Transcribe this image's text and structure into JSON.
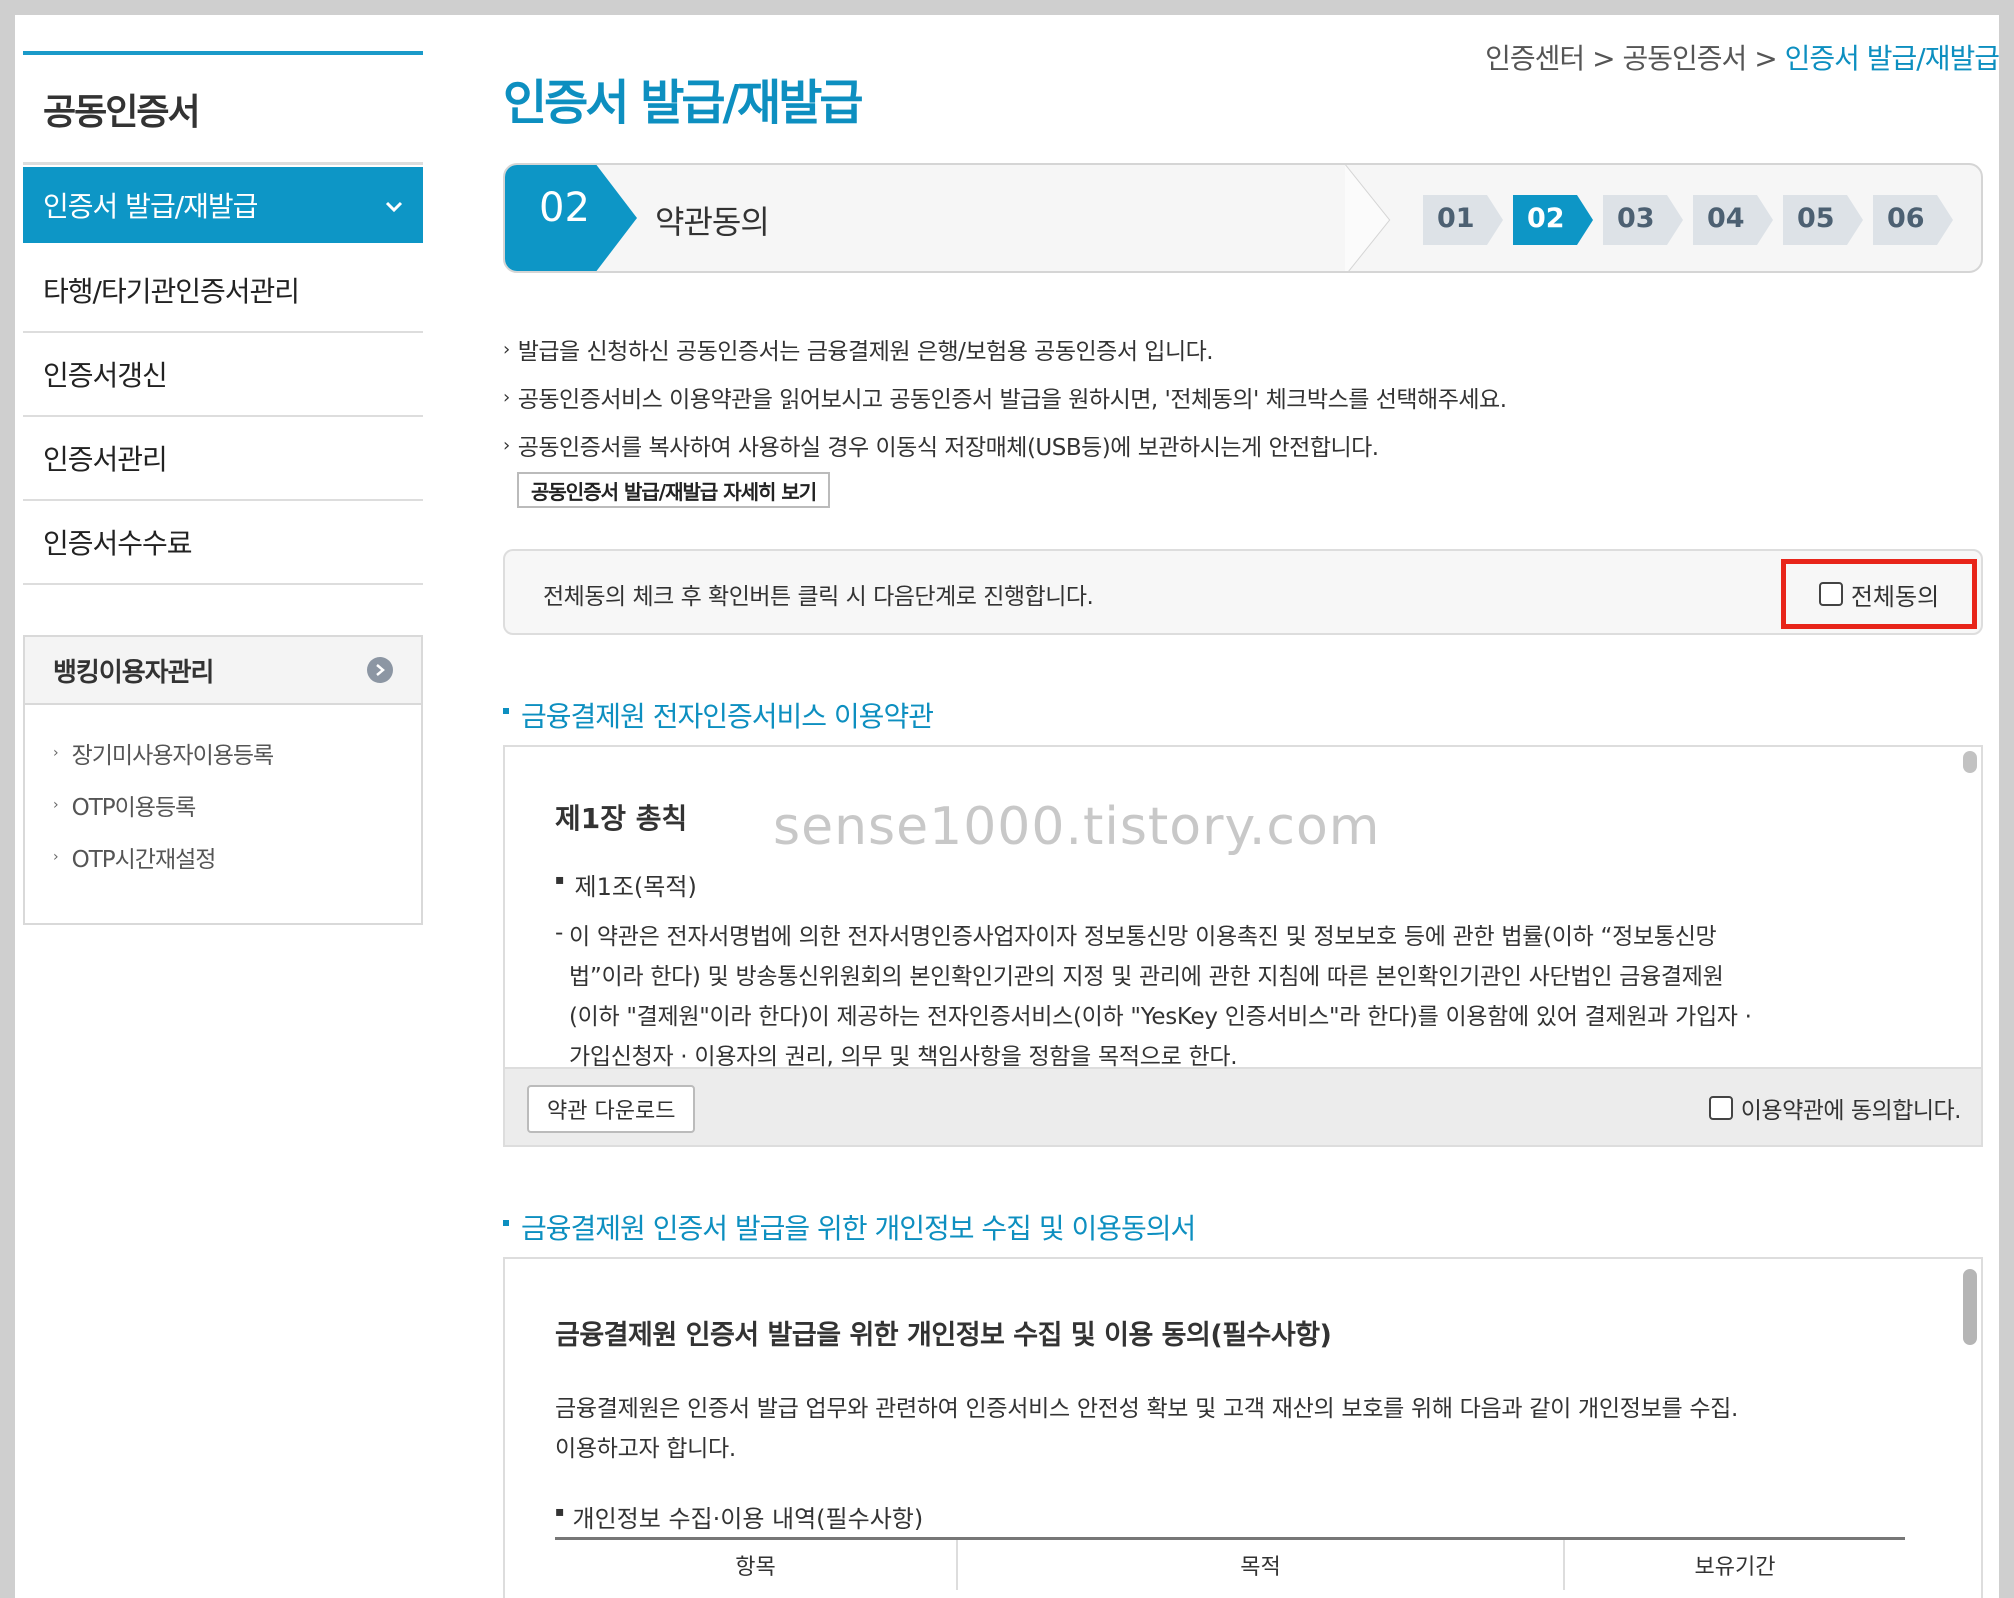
{
  "sidebar": {
    "title": "공동인증서",
    "menu": [
      {
        "label": "인증서 발급/재발급",
        "active": true
      },
      {
        "label": "타행/타기관인증서관리"
      },
      {
        "label": "인증서갱신"
      },
      {
        "label": "인증서관리"
      },
      {
        "label": "인증서수수료"
      }
    ],
    "box": {
      "title": "뱅킹이용자관리",
      "items": [
        "장기미사용자이용등록",
        "OTP이용등록",
        "OTP시간재설정"
      ]
    }
  },
  "breadcrumb": {
    "items": [
      "인증센터",
      "공동인증서"
    ],
    "separator": ">",
    "current": "인증서 발급/재발급"
  },
  "page_title": "인증서 발급/재발급",
  "stepbar": {
    "current_num": "02",
    "current_label": "약관동의",
    "steps": [
      "01",
      "02",
      "03",
      "04",
      "05",
      "06"
    ],
    "active_index": 1
  },
  "notices": [
    "발급을 신청하신 공동인증서는 금융결제원 은행/보험용 공동인증서 입니다.",
    "공동인증서비스 이용약관을 읽어보시고 공동인증서 발급을 원하시면, '전체동의' 체크박스를 선택해주세요.",
    "공동인증서를 복사하여 사용하실 경우 이동식 저장매체(USB등)에 보관하시는게 안전합니다."
  ],
  "detail_button": "공동인증서 발급/재발급 자세히 보기",
  "agree_all": {
    "text": "전체동의 체크 후 확인버튼 클릭 시 다음단계로 진행합니다.",
    "label": "전체동의"
  },
  "section1": {
    "title": "금융결제원 전자인증서비스 이용약관",
    "chapter": "제1장 총칙",
    "article": "제1조(목적)",
    "body_lines": [
      "이 약관은 전자서명법에 의한 전자서명인증사업자이자 정보통신망 이용촉진 및 정보보호 등에 관한 법률(이하 “정보통신망",
      "법”이라 한다) 및 방송통신위원회의 본인확인기관의 지정 및 관리에 관한 지침에 따른 본인확인기관인 사단법인 금융결제원",
      "(이하 \"결제원\"이라 한다)이 제공하는 전자인증서비스(이하 \"YesKey 인증서비스\"라 한다)를 이용함에 있어 결제원과 가입자 ·",
      "가입신청자 · 이용자의 권리, 의무 및 책임사항을 정함을 목적으로 한다."
    ],
    "download_button": "약관 다운로드",
    "agree_label": "이용약관에 동의합니다."
  },
  "watermark": "sense1000.tistory.com",
  "section2": {
    "title": "금융결제원 인증서 발급을 위한 개인정보 수집 및 이용동의서",
    "heading": "금융결제원 인증서 발급을 위한 개인정보 수집 및 이용 동의(필수사항)",
    "intro_lines": [
      "금융결제원은 인증서 발급 업무와 관련하여 인증서비스 안전성 확보 및 고객 재산의 보호를 위해 다음과 같이 개인정보를 수집.",
      "이용하고자 합니다."
    ],
    "subheading": "개인정보 수집·이용 내역(필수사항)",
    "table_headers": [
      "항목",
      "목적",
      "보유기간"
    ]
  },
  "colors": {
    "accent": "#0d96c6",
    "highlight_border": "#e8251a"
  }
}
